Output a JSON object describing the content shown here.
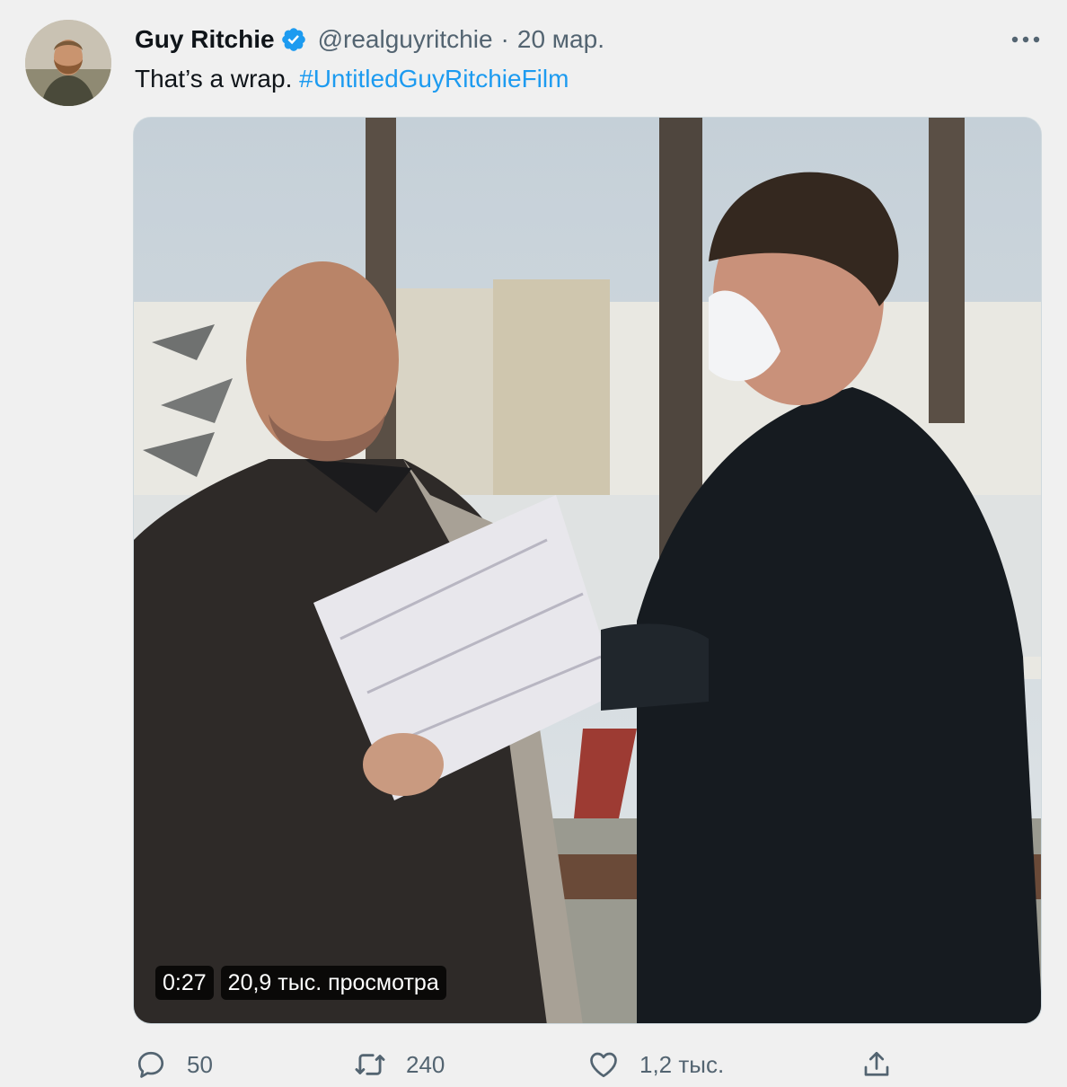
{
  "tweet": {
    "author_name": "Guy Ritchie",
    "handle": "@realguyritchie",
    "separator": "·",
    "date": "20 мар.",
    "text": "That’s a wrap.",
    "hashtag": "#UntitledGuyRitchieFilm"
  },
  "video": {
    "duration": "0:27",
    "views": "20,9 тыс. просмотра"
  },
  "actions": {
    "replies": "50",
    "retweets": "240",
    "likes": "1,2 тыс."
  },
  "icons": {
    "verified": "verified-badge-icon",
    "more": "more-dots-icon",
    "reply": "reply-icon",
    "retweet": "retweet-icon",
    "like": "heart-icon",
    "share": "share-icon"
  },
  "colors": {
    "accent": "#1d9bf0",
    "secondary_text": "#536471",
    "primary_text": "#0f1419",
    "background": "#f0f0f0"
  }
}
